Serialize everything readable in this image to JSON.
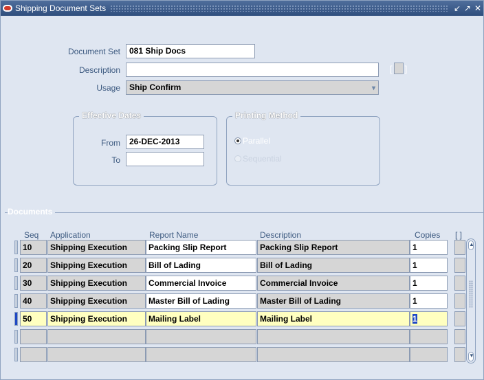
{
  "window": {
    "title": "Shipping Document Sets",
    "controls": [
      "↙",
      "↗",
      "✕"
    ]
  },
  "form": {
    "document_set_label": "Document Set",
    "document_set_value": "081 Ship Docs",
    "description_label": "Description",
    "description_value": "",
    "flex_field": "[ ]",
    "usage_label": "Usage",
    "usage_value": "Ship Confirm"
  },
  "effective_dates": {
    "title": "Effective Dates",
    "from_label": "From",
    "from_value": "26-DEC-2013",
    "to_label": "To",
    "to_value": ""
  },
  "printing_method": {
    "title": "Printing Method",
    "options": [
      {
        "label": "Parallel",
        "selected": true,
        "enabled": true
      },
      {
        "label": "Sequential",
        "selected": false,
        "enabled": false
      }
    ]
  },
  "documents": {
    "title": "Documents",
    "headers": {
      "seq": "Seq",
      "application": "Application",
      "report": "Report Name",
      "description": "Description",
      "copies": "Copies",
      "flex": "[ ]"
    },
    "rows": [
      {
        "seq": "10",
        "application": "Shipping Execution",
        "report": "Packing Slip Report",
        "description": "Packing Slip Report",
        "copies": "1"
      },
      {
        "seq": "20",
        "application": "Shipping Execution",
        "report": "Bill of Lading",
        "description": "Bill of Lading",
        "copies": "1"
      },
      {
        "seq": "30",
        "application": "Shipping Execution",
        "report": "Commercial Invoice",
        "description": "Commercial Invoice",
        "copies": "1"
      },
      {
        "seq": "40",
        "application": "Shipping Execution",
        "report": "Master Bill of Lading",
        "description": "Master Bill of Lading",
        "copies": "1"
      },
      {
        "seq": "50",
        "application": "Shipping Execution",
        "report": "Mailing Label",
        "description": "Mailing Label",
        "copies": "1"
      },
      {
        "seq": "",
        "application": "",
        "report": "",
        "description": "",
        "copies": ""
      },
      {
        "seq": "",
        "application": "",
        "report": "",
        "description": "",
        "copies": ""
      }
    ],
    "current_row": 4
  },
  "colors": {
    "title_bar": "#2f4e7d",
    "form_bg": "#dfe6f1",
    "label": "#3d5a80",
    "selected_row": "#ffffc0",
    "current_indicator": "#1f47c4"
  }
}
